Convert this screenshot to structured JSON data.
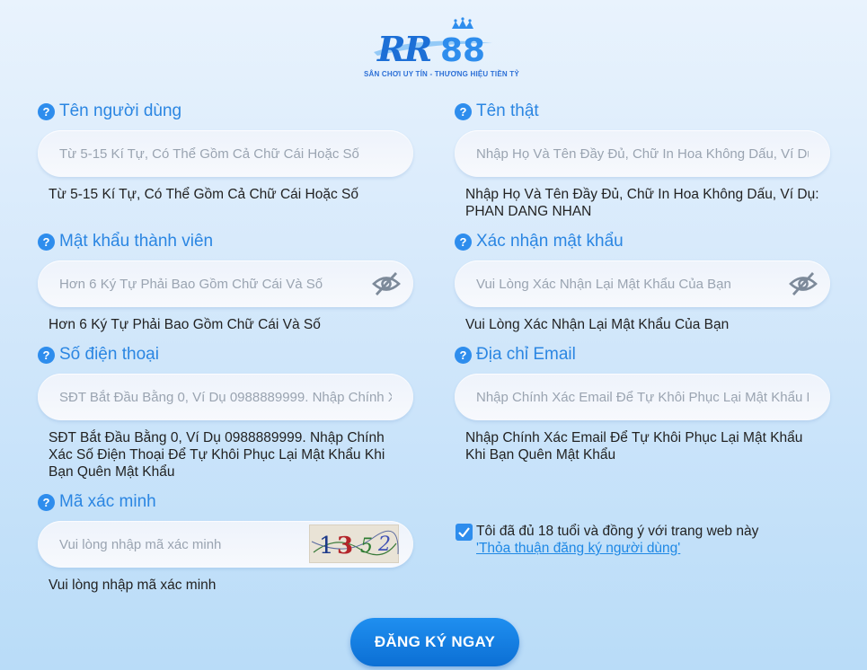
{
  "logo": {
    "brand": "RR88",
    "slogan": "SÂN CHƠI UY TÍN - THƯƠNG HIỆU TIỀN TỶ"
  },
  "fields": {
    "username": {
      "label": "Tên người dùng",
      "placeholder": "Từ 5-15 Kí Tự, Có Thể Gồm Cả Chữ Cái Hoặc Số",
      "hint": "Từ 5-15 Kí Tự, Có Thể Gồm Cả Chữ Cái Hoặc Số"
    },
    "realname": {
      "label": "Tên thật",
      "placeholder": "Nhập Họ Và Tên Đầy Đủ, Chữ In Hoa Không Dấu, Ví Dụ",
      "hint": "Nhập Họ Và Tên Đầy Đủ, Chữ In Hoa Không Dấu, Ví Dụ: PHAN DANG NHAN"
    },
    "password": {
      "label": "Mật khẩu thành viên",
      "placeholder": "Hơn 6 Ký Tự Phải Bao Gồm Chữ Cái Và Số",
      "hint": "Hơn 6 Ký Tự Phải Bao Gồm Chữ Cái Và Số",
      "icon": "eye-off-icon"
    },
    "confirm_password": {
      "label": "Xác nhận mật khẩu",
      "placeholder": "Vui Lòng Xác Nhận Lại Mật Khẩu Của Bạn",
      "hint": "Vui Lòng Xác Nhận Lại Mật Khẩu Của Bạn",
      "icon": "eye-off-icon"
    },
    "phone": {
      "label": "Số điện thoại",
      "placeholder": "SĐT Bắt Đầu Bằng 0, Ví Dụ 0988889999. Nhập Chính X",
      "hint": "SĐT Bắt Đầu Bằng 0, Ví Dụ 0988889999. Nhập Chính Xác Số Điện Thoại Để Tự Khôi Phục Lại Mật Khẩu Khi Bạn Quên Mật Khẩu"
    },
    "email": {
      "label": "Địa chỉ Email",
      "placeholder": "Nhập Chính Xác Email Để Tự Khôi Phục Lại Mật Khẩu K",
      "hint": "Nhập Chính Xác Email Để Tự Khôi Phục Lại Mật Khẩu Khi Bạn Quên Mật Khẩu"
    },
    "captcha": {
      "label": "Mã xác minh",
      "placeholder": "Vui lòng nhập mã xác minh",
      "hint": "Vui lòng nhập mã xác minh",
      "code": "1352"
    }
  },
  "agreement": {
    "checked": true,
    "text": "Tôi đã đủ 18 tuổi và đồng ý với trang web này",
    "link": "'Thỏa thuận đăng ký người dùng'"
  },
  "submit_label": "ĐĂNG KÝ NGAY",
  "colors": {
    "accent": "#2b86e2",
    "button": "#0c6fd4",
    "background": "#d6e9fb"
  }
}
